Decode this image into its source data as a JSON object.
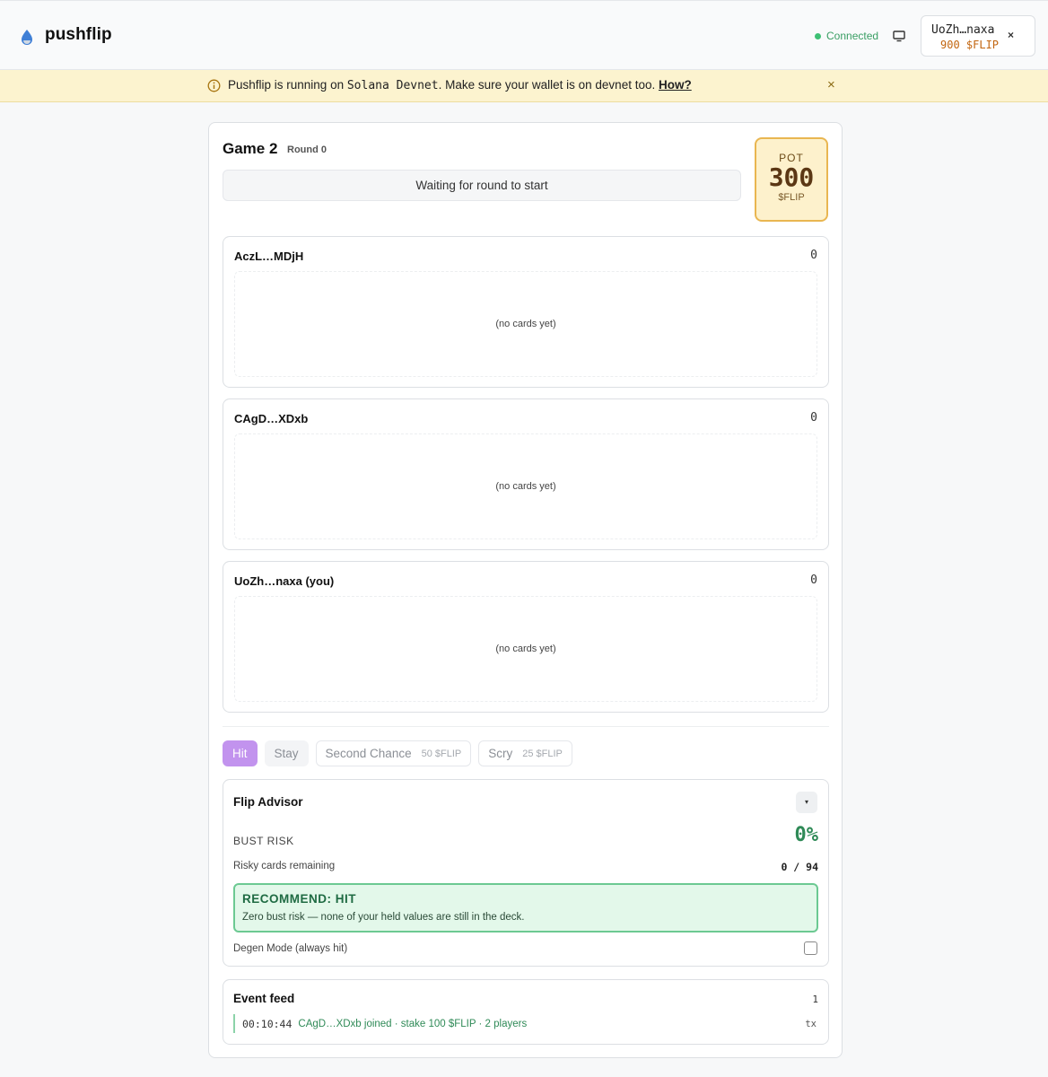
{
  "header": {
    "brand": "pushflip",
    "status": "Connected",
    "wallet": {
      "address": "UoZh…naxa",
      "balance": "900 $FLIP",
      "close": "×"
    }
  },
  "banner": {
    "prefix": "Pushflip is running on ",
    "network": "Solana Devnet",
    "suffix": ". Make sure your wallet is on devnet too. ",
    "link": "How?",
    "close": "×"
  },
  "game": {
    "title": "Game 2",
    "round": "Round 0",
    "status": "Waiting for round to start",
    "pot": {
      "label": "POT",
      "value": "300",
      "unit": "$FLIP"
    },
    "players": [
      {
        "name": "AczL…MDjH",
        "score": "0",
        "cards": "(no cards yet)"
      },
      {
        "name": "CAgD…XDxb",
        "score": "0",
        "cards": "(no cards yet)"
      },
      {
        "name": "UoZh…naxa (you)",
        "score": "0",
        "cards": "(no cards yet)"
      }
    ],
    "actions": {
      "hit": "Hit",
      "stay": "Stay",
      "second_chance": {
        "label": "Second Chance",
        "cost": "50 $FLIP"
      },
      "scry": {
        "label": "Scry",
        "cost": "25 $FLIP"
      }
    }
  },
  "advisor": {
    "title": "Flip Advisor",
    "toggle": "▾",
    "bust_risk_label": "BUST RISK",
    "bust_risk_value": "0%",
    "risky_label": "Risky cards remaining",
    "risky_value": "0 / 94",
    "recommend_title": "RECOMMEND: HIT",
    "recommend_text": "Zero bust risk — none of your held values are still in the deck.",
    "degen_label": "Degen Mode (always hit)",
    "degen_checked": false
  },
  "feed": {
    "title": "Event feed",
    "count": "1",
    "events": [
      {
        "time": "00:10:44",
        "text": "CAgD…XDxb joined · stake 100 $FLIP · 2 players",
        "tx": "tx"
      }
    ]
  },
  "colors": {
    "accent": "#c293ee",
    "connected": "#3ec074",
    "pot_border": "#e9b651",
    "recommend_border": "#6cc992"
  }
}
